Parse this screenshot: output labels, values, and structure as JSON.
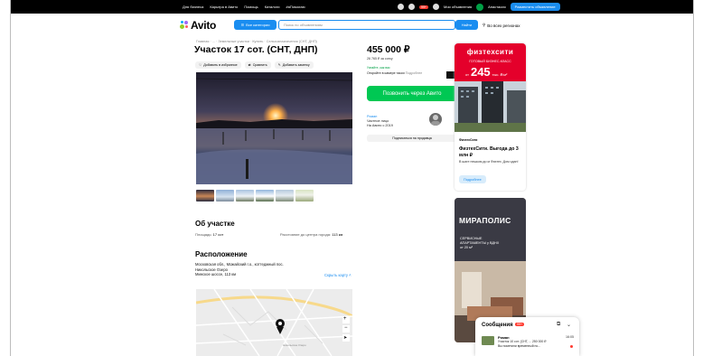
{
  "topbar": {
    "links": [
      "Для бизнеса",
      "Карьера в Авито",
      "Помощь",
      "Каталоги",
      "#яПомогаю"
    ],
    "cart_badge": "99+",
    "my_ads": "Мои объявления",
    "user": "Анастасия",
    "place_ad": "Разместить объявление"
  },
  "header": {
    "logo": "Avito",
    "categories": "Все категории",
    "search_placeholder": "Поиск по объявлениям",
    "search_button": "Найти",
    "region": "Во всех регионах"
  },
  "breadcrumbs": "Главная · ... · Земельные участки · Купить · Сельхозназначения (СНТ, ДНП)",
  "listing": {
    "title": "Участок 17 сот. (СНТ, ДНП)",
    "actions": [
      "Добавить в избранное",
      "Сравнить",
      "Добавить заметку"
    ],
    "about_title": "Об участке",
    "area_label": "Площадь:",
    "area_value": "17 сот",
    "distance_label": "Расстояние до центра города:",
    "distance_value": "113 км",
    "location_title": "Расположение",
    "address": [
      "Московская обл., Можайский г.о., коттеджный пос.",
      "Никольское Озеро",
      "Минское шоссе, 113 км"
    ],
    "hide_map": "Скрыть карту ˄",
    "map_label": "Никольское Озеро"
  },
  "sidebar": {
    "price": "455 000 ₽",
    "per_unit": "26 765 ₽ за сотку",
    "scan_label": "Узнайте, как вас",
    "scan_text": "Откройте в камере такси",
    "scan_more": "Подробнее",
    "call_button": "Позвонить через Авито",
    "seller_name": "Роман",
    "seller_type": "Частное лицо",
    "seller_since": "На Авито с 2019",
    "subscribe": "Подписаться на продавца"
  },
  "ad1": {
    "brand": "физтехсити",
    "line1": "ГОТОВЫЙ БИЗНЕС-КЛАСС",
    "prefix": "от",
    "big": "245",
    "suffix": "тыс. ₽/м²",
    "brand_small": "ФизтехСити",
    "title": "ФизтехСити. Выгода до 3 млн ₽",
    "text": "В шаге пешком до м Физтех. Дом сдан!",
    "button": "Подробнее"
  },
  "ad2": {
    "brand": "МИРАПОЛИС",
    "line1": "СЕРВИСНЫЕ",
    "line2": "АПАРТАМЕНТЫ у ВДНХ",
    "line3": "от 20 м²"
  },
  "messages": {
    "title": "Сообщения",
    "count": "99+",
    "items": [
      {
        "name": "Роман",
        "time": "16:05",
        "subject": "Участок 10 сот. (СНТ, ... 250 000 ₽",
        "preview": "Вы пометили временный но..."
      }
    ]
  },
  "colors": {
    "accent": "#1a8df0",
    "call": "#00c853",
    "ad_red": "#e4002b"
  }
}
